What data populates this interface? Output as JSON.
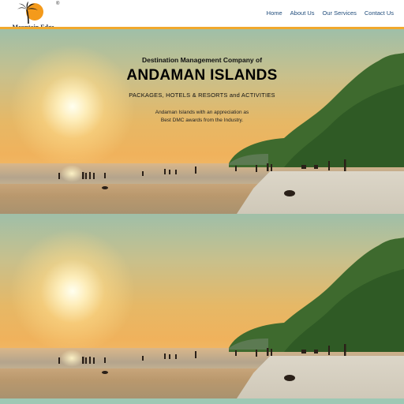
{
  "logo": {
    "name": "Mountain Edge",
    "tagline": "TOURS & TRAVELS · ANDAMAN ISLANDS",
    "registered": "®"
  },
  "nav": {
    "items": [
      {
        "label": "Home"
      },
      {
        "label": "About Us"
      },
      {
        "label": "Our Services"
      },
      {
        "label": "Contact Us"
      }
    ]
  },
  "hero": {
    "subtitle": "Destination Management Company of",
    "title": "ANDAMAN ISLANDS",
    "services": "PACKAGES, HOTELS & RESORTS and ACTIVITIES",
    "award_line1": "Andaman Islands with an appreciation as",
    "award_line2": "Best DMC awards from the Industry."
  },
  "colors": {
    "accent": "#f0a92c",
    "nav_text": "#1f4b7a",
    "brand_dark": "#1f2a44"
  }
}
